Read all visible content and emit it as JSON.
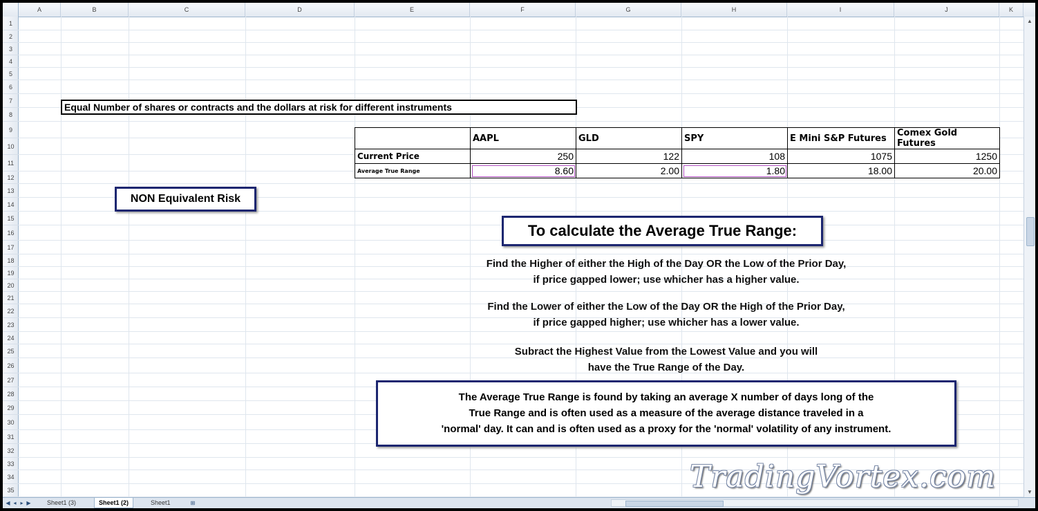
{
  "columns": [
    "A",
    "B",
    "C",
    "D",
    "E",
    "F",
    "G",
    "H",
    "I",
    "J",
    "K"
  ],
  "rows": [
    "1",
    "2",
    "3",
    "4",
    "5",
    "6",
    "7",
    "8",
    "9",
    "10",
    "11",
    "12",
    "13",
    "14",
    "15",
    "16",
    "17",
    "18",
    "19",
    "20",
    "21",
    "22",
    "23",
    "24",
    "25",
    "26",
    "27",
    "28",
    "29",
    "30",
    "31",
    "32",
    "33",
    "34",
    "35"
  ],
  "title": "Equal Number of shares or contracts and the dollars at risk for different instruments",
  "table": {
    "headers": [
      "AAPL",
      "GLD",
      "SPY",
      "E Mini S&P Futures",
      "Comex Gold Futures"
    ],
    "current_price_label": "Current Price",
    "current_price": [
      "250",
      "122",
      "108",
      "1075",
      "1250"
    ],
    "atr_label": "Average True Range",
    "atr": [
      "8.60",
      "2.00",
      "1.80",
      "18.00",
      "20.00"
    ]
  },
  "non_equivalent": "NON Equivalent Risk",
  "atr_title": "To calculate the Average True Range:",
  "paragraphs": {
    "p1_l1": "Find the Higher of either the High of the Day OR the Low of the Prior Day,",
    "p1_l2": "if price gapped lower; use whicher has a higher value.",
    "p2_l1": "Find the Lower of either the Low of the Day OR the High of the Prior Day,",
    "p2_l2": "if price gapped higher; use whicher has a lower value.",
    "p3_l1": "Subract the Highest Value from the Lowest Value and you will",
    "p3_l2": "have the True Range of the Day."
  },
  "explanation": {
    "l1": "The Average True Range is found by taking an average X number of days long of the",
    "l2": "True Range and is often used as a measure of the average distance traveled in a",
    "l3": "'normal' day. It can and is often used as a proxy for the 'normal' volatility of any instrument."
  },
  "sheet_tabs": [
    "Sheet1 (3)",
    "Sheet1 (2)",
    "Sheet1"
  ],
  "active_tab": "Sheet1 (2)",
  "nav_icons": [
    "first-sheet-icon",
    "prev-sheet-icon",
    "next-sheet-icon",
    "last-sheet-icon"
  ],
  "watermark": "TradingVortex.com",
  "colors": {
    "box_border": "#1c2670",
    "highlight_cell": "#b050c0"
  }
}
